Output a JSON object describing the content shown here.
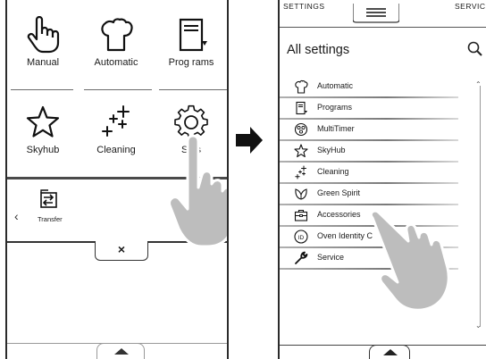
{
  "left_screen": {
    "tiles": [
      {
        "label": "Manual",
        "icon": "hand-pointer-icon"
      },
      {
        "label": "Automatic",
        "icon": "chef-hat-icon"
      },
      {
        "label": "Prog rams",
        "icon": "recipe-book-icon"
      },
      {
        "label": "Skyhub",
        "icon": "star-icon"
      },
      {
        "label": "Cleaning",
        "icon": "sparkles-icon"
      },
      {
        "label": "S      gs",
        "icon": "gear-icon"
      }
    ],
    "tray": {
      "transfer_label": "Transfer",
      "chevron": "‹",
      "close_symbol": "×"
    }
  },
  "right_screen": {
    "tabs": {
      "left": "SETTINGS",
      "right": "SERVICE"
    },
    "title": "All settings",
    "items": [
      {
        "label": "Automatic",
        "icon": "chef-hat-icon"
      },
      {
        "label": "Programs",
        "icon": "recipe-book-icon"
      },
      {
        "label": "MultiTimer",
        "icon": "multitimer-icon"
      },
      {
        "label": "SkyHub",
        "icon": "star-icon"
      },
      {
        "label": "Cleaning",
        "icon": "sparkles-icon"
      },
      {
        "label": "Green Spirit",
        "icon": "leaf-icon"
      },
      {
        "label": "Accessories",
        "icon": "toolbox-icon"
      },
      {
        "label": "Oven Identity C",
        "icon": "id-icon"
      },
      {
        "label": "Service",
        "icon": "wrench-icon"
      }
    ]
  }
}
